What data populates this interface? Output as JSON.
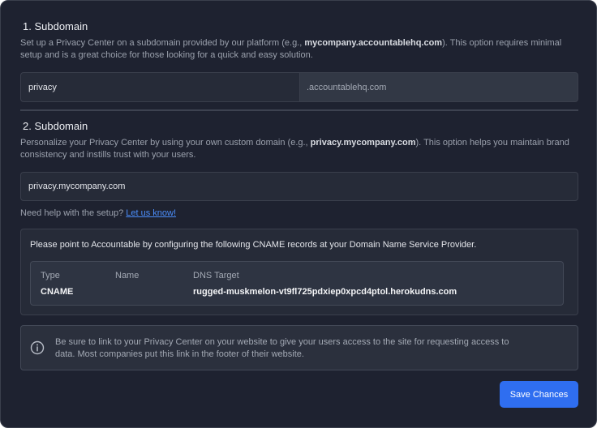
{
  "section1": {
    "title": "1. Subdomain",
    "desc_before": "Set up a Privacy Center on a subdomain provided by our platform (e.g., ",
    "desc_bold": "mycompany.accountablehq.com",
    "desc_after": "). This option requires minimal setup and is a great choice for those looking for a quick and easy solution.",
    "subdomain_value": "privacy",
    "suffix": ".accountablehq.com"
  },
  "section2": {
    "title": "2. Subdomain",
    "desc_before": "Personalize your Privacy Center by using your own custom domain (e.g., ",
    "desc_bold": "privacy.mycompany.com",
    "desc_after": "). This option helps you maintain brand consistency and instills trust with your users.",
    "domain_value": "privacy.mycompany.com",
    "help_text": "Need help with the setup? ",
    "help_link": "Let us know!"
  },
  "cname": {
    "instruction": "Please point to Accountable by configuring the following CNAME records at your Domain Name Service Provider.",
    "headers": [
      "Type",
      "Name",
      "DNS Target"
    ],
    "row": {
      "type": "CNAME",
      "name": "",
      "target": "rugged-muskmelon-vt9fl725pdxiep0xpcd4ptol.herokudns.com"
    }
  },
  "info": {
    "text": "Be sure to link to your Privacy Center on your website to give your users access to the site for requesting access to data. Most companies put this link in the footer of their website."
  },
  "actions": {
    "save_label": "Save Chances"
  },
  "colors": {
    "background": "#1e2230",
    "accent": "#2f6ef0",
    "link": "#4b8df8"
  }
}
